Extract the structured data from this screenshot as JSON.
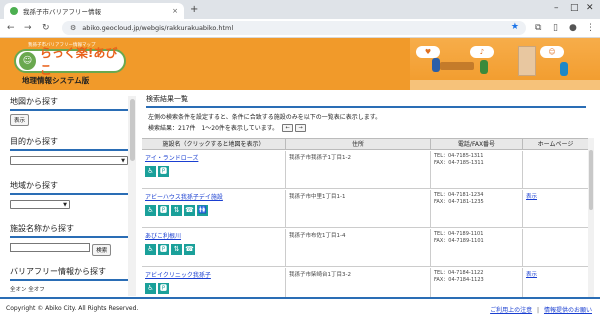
{
  "browser": {
    "tab_title": "我孫子市バリアフリー情報",
    "tab_close": "×",
    "new_tab": "+",
    "url": "abiko.geocloud.jp/webgis/rakkurakuabiko.html"
  },
  "header": {
    "tagline": "我孫子市バリアフリー情報マップ",
    "logo_text": "らっく楽!あびこ",
    "subtitle": "地理情報システム版"
  },
  "sidebar": {
    "sections": [
      {
        "title": "地図から探す",
        "button": "表示"
      },
      {
        "title": "目的から探す"
      },
      {
        "title": "地域から探す"
      },
      {
        "title": "施設名称から探す",
        "button": "検索"
      },
      {
        "title": "バリアフリー情報から探す",
        "toggles": "全オン 全オフ"
      }
    ]
  },
  "main": {
    "title": "検索結果一覧",
    "description": "左側の検索条件を設定すると、条件に合致する施設のみを以下の一覧表に表示します。",
    "count": "検索結果：217件　1〜20件を表示しています。",
    "prev": "←",
    "next": "→",
    "columns": [
      "施設名（クリックすると地図を表示）",
      "住所",
      "電話/FAX番号",
      "ホームページ"
    ],
    "rows": [
      {
        "name": "アイ・ランドローズ",
        "address": "我孫子市我孫子1丁目1-2",
        "tel": "TEL：04-7185-1311",
        "fax": "FAX：04-7185-1311",
        "homepage": "",
        "icons": [
          "♿",
          "🅿"
        ]
      },
      {
        "name": "アビーハウス我孫子デイ施設",
        "address": "我孫子市中里1丁目1-1",
        "tel": "TEL：04-7181-1234",
        "fax": "FAX：04-7181-1235",
        "homepage": "表示",
        "icons": [
          "♿",
          "🅿",
          "⇅",
          "☎",
          "🚻"
        ]
      },
      {
        "name": "あびこ利根川",
        "address": "我孫子市布佐1丁目1-4",
        "tel": "TEL：04-7189-1101",
        "fax": "FAX：04-7189-1101",
        "homepage": "",
        "icons": [
          "♿",
          "🅿",
          "⇅",
          "☎"
        ]
      },
      {
        "name": "アビイクリニック我孫子",
        "address": "我孫子市柴崎台1丁目3-2",
        "tel": "TEL：04-7184-1122",
        "fax": "FAX：04-7184-1123",
        "homepage": "表示",
        "icons": [
          "♿",
          "🅿"
        ]
      }
    ]
  },
  "footer": {
    "copyright": "Copyright © Abiko City. All Rights Reserved.",
    "link1": "ご利用上の注意",
    "separator": "|",
    "link2": "情報提供のお願い"
  }
}
